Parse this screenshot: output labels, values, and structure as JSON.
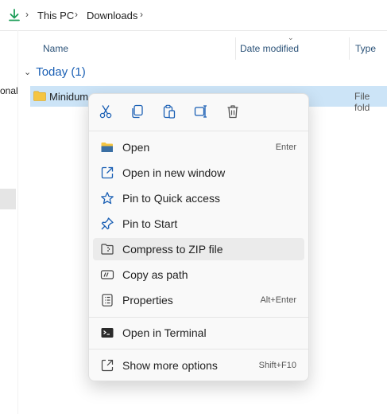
{
  "address": {
    "crumbs": [
      "This PC",
      "Downloads"
    ],
    "separator": "›"
  },
  "nav": {
    "truncated_label": "onal"
  },
  "columns": {
    "name": "Name",
    "date": "Date modified",
    "type": "Type"
  },
  "group": {
    "label": "Today (1)"
  },
  "file": {
    "name": "Minidum",
    "date": "",
    "type": "File fold"
  },
  "menu": {
    "quick_actions": [
      "cut-icon",
      "copy-icon",
      "paste-icon",
      "rename-icon",
      "delete-icon"
    ],
    "items": [
      {
        "label": "Open",
        "shortcut": "Enter",
        "icon": "folder-open-icon"
      },
      {
        "label": "Open in new window",
        "shortcut": "",
        "icon": "open-new-window-icon"
      },
      {
        "label": "Pin to Quick access",
        "shortcut": "",
        "icon": "star-icon"
      },
      {
        "label": "Pin to Start",
        "shortcut": "",
        "icon": "pin-icon"
      },
      {
        "label": "Compress to ZIP file",
        "shortcut": "",
        "icon": "zip-icon"
      },
      {
        "label": "Copy as path",
        "shortcut": "",
        "icon": "copy-path-icon"
      },
      {
        "label": "Properties",
        "shortcut": "Alt+Enter",
        "icon": "properties-icon"
      },
      {
        "label": "Open in Terminal",
        "shortcut": "",
        "icon": "terminal-icon"
      },
      {
        "label": "Show more options",
        "shortcut": "Shift+F10",
        "icon": "more-options-icon"
      }
    ]
  },
  "colors": {
    "accent": "#1a5fb4",
    "selection": "#cce4f7",
    "folder": "#f5c542",
    "download": "#1e9e5a"
  }
}
